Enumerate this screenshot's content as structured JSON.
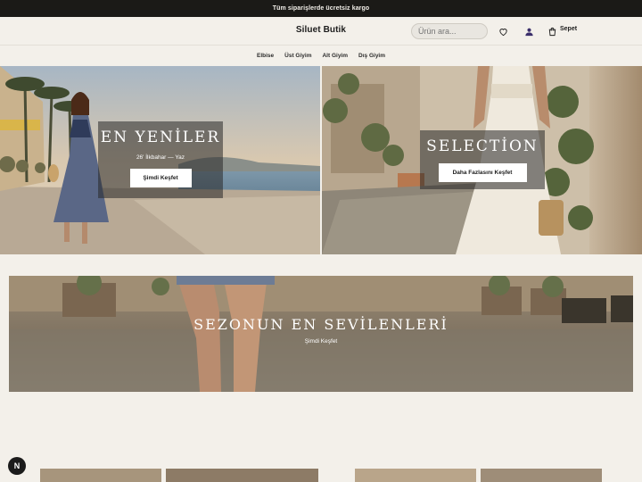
{
  "announcement": "Tüm siparişlerde ücretsiz kargo",
  "brand": "Siluet Butik",
  "search": {
    "placeholder": "Ürün ara..."
  },
  "header": {
    "cart_label": "Sepet"
  },
  "nav": [
    "Elbise",
    "Üst Giyim",
    "Alt Giyim",
    "Dış Giyim"
  ],
  "hero_left": {
    "title": "EN YENİLER",
    "subtitle": "26' İlkbahar — Yaz",
    "button": "Şimdi Keşfet"
  },
  "hero_right": {
    "title": "SELECTİON",
    "button": "Daha Fazlasını Keşfet"
  },
  "banner": {
    "title": "SEZONUN EN SEVİLENLERİ",
    "link": "Şimdi Keşfet"
  },
  "badge": "N",
  "colors": {
    "announcement_bg": "#1b1a17",
    "page_bg": "#f3f0ea",
    "overlay": "#282828"
  }
}
